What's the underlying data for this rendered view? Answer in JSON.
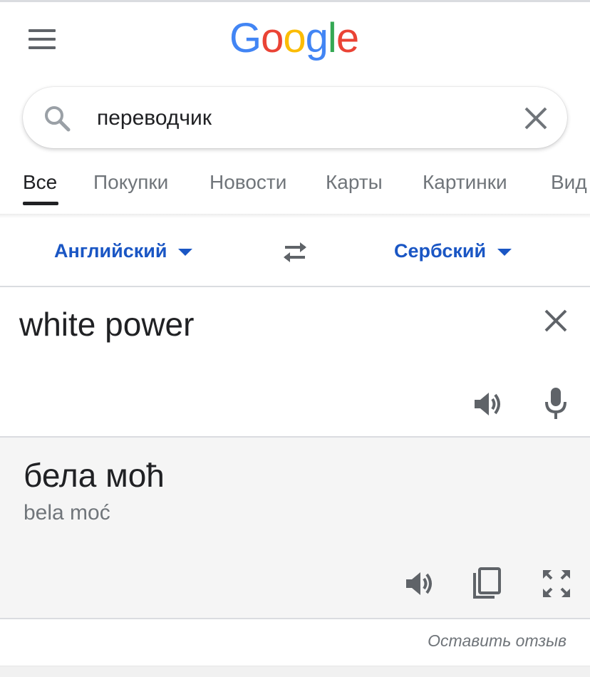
{
  "header": {
    "logo": {
      "letters": [
        "G",
        "o",
        "o",
        "g",
        "l",
        "e"
      ],
      "colors": [
        "#4285F4",
        "#EA4335",
        "#FBBC05",
        "#4285F4",
        "#34A853",
        "#EA4335"
      ]
    },
    "menu_icon": "hamburger-menu-icon"
  },
  "search": {
    "query": "переводчик",
    "search_icon": "search-icon",
    "clear_icon": "close-icon"
  },
  "tabs": {
    "items": [
      {
        "label": "Все",
        "active": true
      },
      {
        "label": "Покупки",
        "active": false
      },
      {
        "label": "Новости",
        "active": false
      },
      {
        "label": "Карты",
        "active": false
      },
      {
        "label": "Картинки",
        "active": false
      },
      {
        "label": "Вид",
        "active": false
      }
    ]
  },
  "translator": {
    "source_lang": "Английский",
    "target_lang": "Сербский",
    "swap_icon": "swap-arrows-icon",
    "source_text": "white power",
    "target_text": "бела моћ",
    "transliteration": "bela moć",
    "feedback": "Оставить отзыв",
    "accent_color": "#1a56c4"
  }
}
